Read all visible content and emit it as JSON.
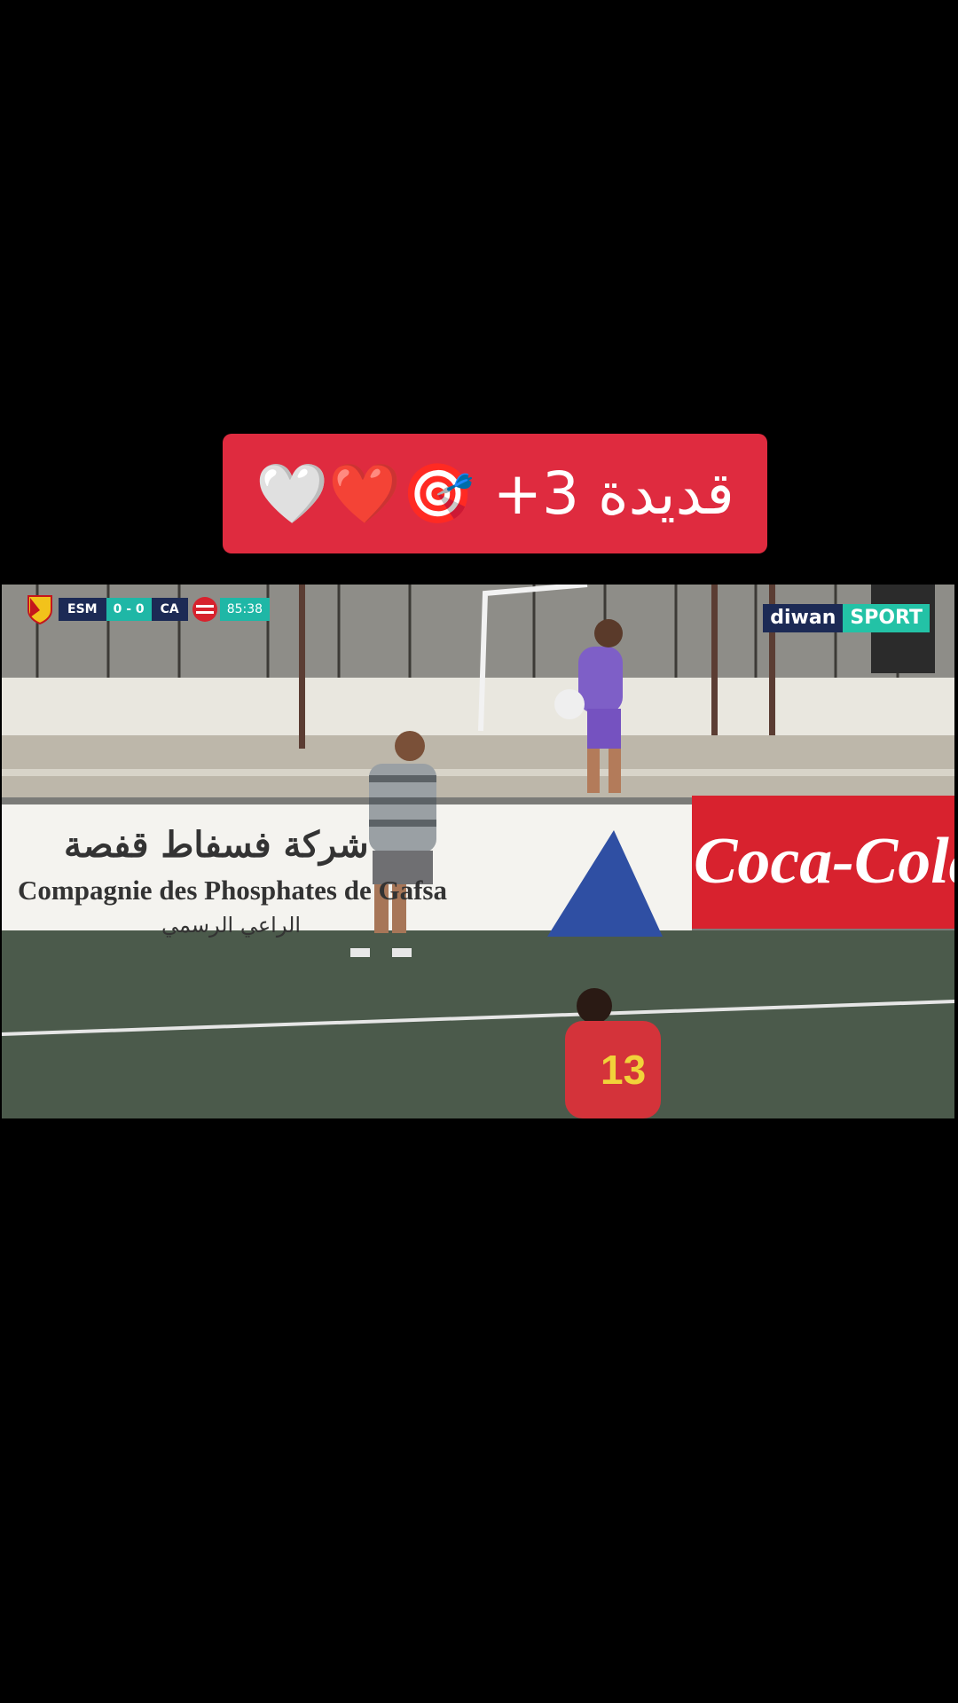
{
  "caption": {
    "text": "قديدة 3+ 🎯❤️🤍"
  },
  "broadcast": {
    "home_team": "ESM",
    "score": "0 - 0",
    "away_team": "CA",
    "match_clock": "85:38",
    "channel_logo": {
      "part1": "diwan",
      "part2": "SPORT"
    }
  },
  "pitch": {
    "board_left_arabic": "شركة فسفاط قفصة",
    "board_left_french": "Compagnie des Phosphates de Gafsa",
    "board_left_arabic_sub": "الراعي الرسمي",
    "board_right": "Coca-Cola",
    "player_number": "13"
  },
  "colors": {
    "caption_bg": "#df2b3f",
    "score_teal": "#1fb7a6",
    "navy": "#1c2a55"
  }
}
